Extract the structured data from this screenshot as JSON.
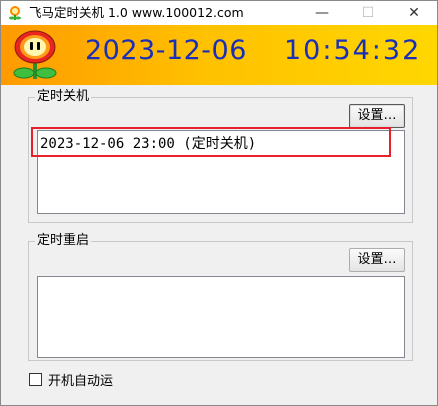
{
  "window": {
    "title": "飞马定时关机 1.0  www.100012.com",
    "minimize_glyph": "—",
    "maximize_glyph": "☐",
    "close_glyph": "✕"
  },
  "banner": {
    "date": "2023-12-06",
    "time": "10:54:32"
  },
  "shutdown_group": {
    "label": "定时关机",
    "set_button": "设置…",
    "entries": [
      "2023-12-06 23:00      (定时关机)"
    ]
  },
  "restart_group": {
    "label": "定时重启",
    "set_button": "设置…",
    "entries": []
  },
  "autostart": {
    "label": "开机自动运",
    "checked": false
  },
  "colors": {
    "banner_text": "#1a2fb8",
    "highlight_box": "#e8202a"
  },
  "icons": [
    "flower-icon",
    "app-flower-icon"
  ]
}
